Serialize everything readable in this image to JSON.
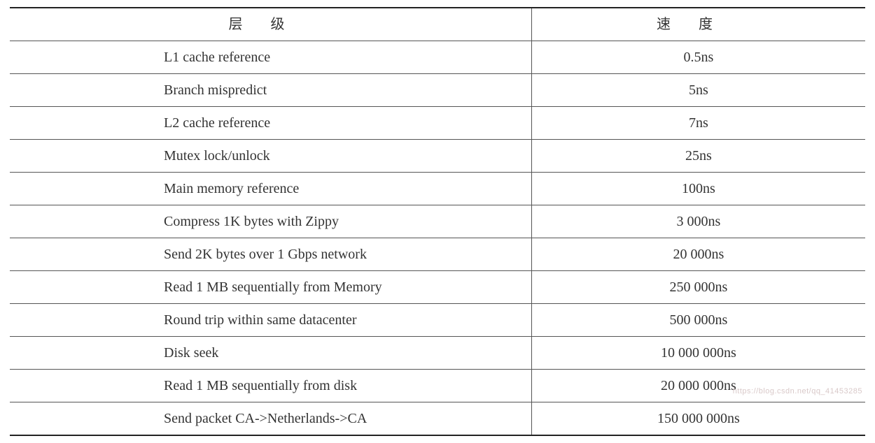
{
  "table": {
    "headers": {
      "level": "层级",
      "speed": "速度"
    },
    "rows": [
      {
        "level": "L1 cache reference",
        "speed": "0.5ns"
      },
      {
        "level": "Branch mispredict",
        "speed": "5ns"
      },
      {
        "level": "L2 cache reference",
        "speed": "7ns"
      },
      {
        "level": "Mutex lock/unlock",
        "speed": "25ns"
      },
      {
        "level": "Main memory reference",
        "speed": "100ns"
      },
      {
        "level": "Compress 1K bytes with Zippy",
        "speed": "3 000ns"
      },
      {
        "level": "Send 2K bytes over 1 Gbps network",
        "speed": "20 000ns"
      },
      {
        "level": "Read 1 MB sequentially from Memory",
        "speed": "250 000ns"
      },
      {
        "level": "Round trip within same datacenter",
        "speed": "500 000ns"
      },
      {
        "level": "Disk seek",
        "speed": "10 000 000ns"
      },
      {
        "level": "Read 1 MB sequentially from disk",
        "speed": "20 000 000ns"
      },
      {
        "level": "Send packet CA->Netherlands->CA",
        "speed": "150 000 000ns"
      }
    ]
  },
  "watermark": "https://blog.csdn.net/qq_41453285"
}
